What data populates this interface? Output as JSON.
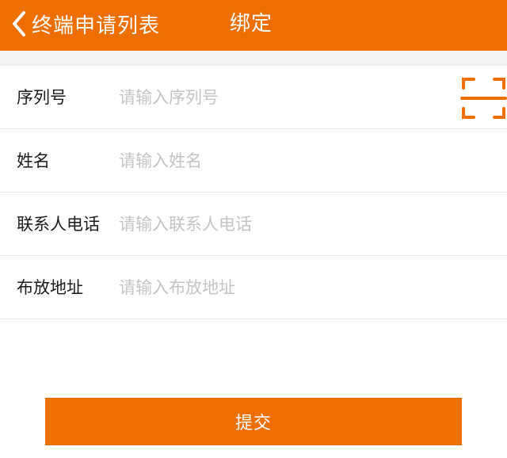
{
  "header": {
    "back_label": "终端申请列表",
    "title": "绑定",
    "background": "#ee6f00"
  },
  "form": {
    "fields": [
      {
        "label": "序列号",
        "placeholder": "请输入序列号",
        "value": "",
        "icon": "scan-icon"
      },
      {
        "label": "姓名",
        "placeholder": "请输入姓名",
        "value": ""
      },
      {
        "label": "联系人电话",
        "placeholder": "请输入联系人电话",
        "value": ""
      },
      {
        "label": "布放地址",
        "placeholder": "请输入布放地址",
        "value": ""
      }
    ]
  },
  "actions": {
    "submit_label": "提交"
  },
  "colors": {
    "accent": "#ee6f00",
    "placeholder": "#c4c4c4",
    "separator": "#e6e6e6"
  }
}
